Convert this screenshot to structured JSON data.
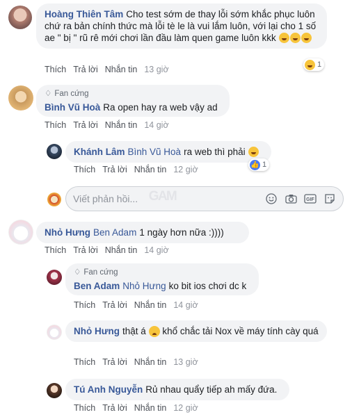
{
  "actions": {
    "like": "Thích",
    "reply": "Trả lời",
    "message": "Nhắn tin"
  },
  "comments": [
    {
      "name": "Hoàng Thiên Tâm",
      "text": "Cho test sớm de thay lỗi sớm khắc phục luôn chứ ra bản chính thức mà lỗi tè le là vui lắm luôn, với lại cho 1 số ae \" bị \" rũ rê mới chơi lần đầu làm quen game luôn kkk",
      "time": "13 giờ",
      "reaction_count": "1"
    },
    {
      "badge": "Fan cứng",
      "name": "Bình Vũ Hoà",
      "text": "Ra open hay ra web vậy ad",
      "time": "14 giờ"
    },
    {
      "name": "Khánh Lâm",
      "mention": "Bình Vũ Hoà",
      "text": "ra web thì phải",
      "time": "12 giờ",
      "reaction_count": "1"
    },
    {
      "name": "Nhỏ Hưng",
      "mention": "Ben Adam",
      "text": "1 ngày hơn nữa :))))",
      "time": "14 giờ"
    },
    {
      "badge": "Fan cứng",
      "name": "Ben Adam",
      "mention": "Nhỏ Hưng",
      "text": "ko bit ios chơi dc k",
      "time": "14 giờ"
    },
    {
      "name": "Nhỏ Hưng",
      "text_a": "thật á",
      "text_b": "khổ chắc tải Nox về máy tính cày quá",
      "time": "13 giờ"
    },
    {
      "name": "Tú Anh Nguyễn",
      "text": "Rủ nhau quẩy tiếp ah mấy đứa.",
      "time": "12 giờ"
    }
  ],
  "reply_input": {
    "placeholder": "Viết phản hồi..."
  },
  "icons": [
    "smiley-icon",
    "camera-icon",
    "gif-icon",
    "sticker-icon",
    "like-reaction-icon",
    "haha-reaction-icon",
    "diamond-icon"
  ]
}
